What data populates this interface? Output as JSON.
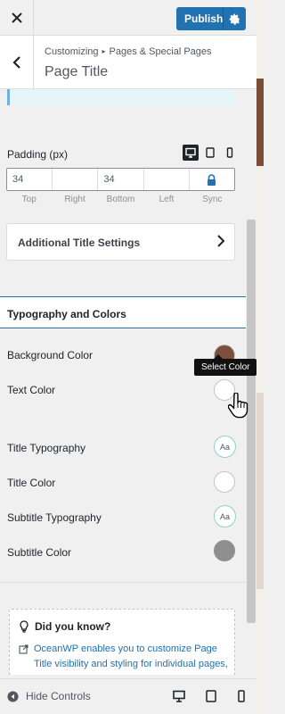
{
  "header": {
    "publish_label": "Publish",
    "breadcrumb_root": "Customizing",
    "breadcrumb_section": "Pages & Special Pages",
    "title": "Page Title"
  },
  "padding": {
    "label": "Padding (px)",
    "values": {
      "top": "34",
      "right": "",
      "bottom": "34",
      "left": ""
    },
    "sides": [
      "Top",
      "Right",
      "Bottom",
      "Left",
      "Sync"
    ]
  },
  "additional": {
    "label": "Additional Title Settings"
  },
  "typography_section": {
    "heading": "Typography and Colors"
  },
  "controls": [
    {
      "label": "Background Color",
      "kind": "color",
      "color": "#7b4f39"
    },
    {
      "label": "Text Color",
      "kind": "color",
      "color": "#ffffff"
    },
    {
      "label": "Title Typography",
      "kind": "typography",
      "glyph": "Aa"
    },
    {
      "label": "Title Color",
      "kind": "color",
      "color": "#ffffff"
    },
    {
      "label": "Subtitle Typography",
      "kind": "typography",
      "glyph": "Aa"
    },
    {
      "label": "Subtitle Color",
      "kind": "color",
      "color": "#8f8f8f"
    }
  ],
  "tooltip": "Select Color",
  "did_you_know": {
    "title": "Did you know?",
    "body": "OceanWP enables you to customize Page Title visibility and styling for individual pages, giving you more control over"
  },
  "footer": {
    "hide_label": "Hide Controls"
  },
  "colors": {
    "accent": "#2271b1",
    "panel": "#f0f0f1"
  }
}
